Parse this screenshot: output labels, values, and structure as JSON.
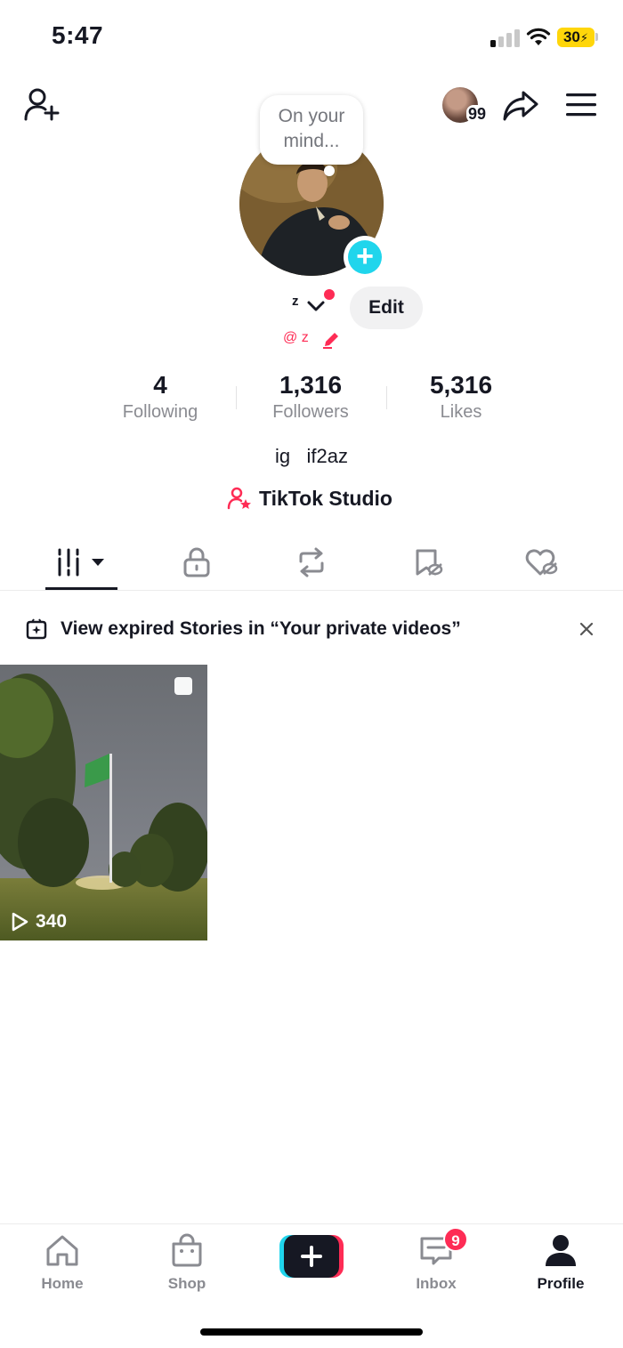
{
  "status_bar": {
    "time": "5:47",
    "battery": "30"
  },
  "header": {
    "notification_count": "99"
  },
  "profile": {
    "bubble_text": "On your mind...",
    "username": "z",
    "handle": "@ z",
    "edit_label": "Edit",
    "stats": [
      {
        "value": "4",
        "label": "Following"
      },
      {
        "value": "1,316",
        "label": "Followers"
      },
      {
        "value": "5,316",
        "label": "Likes"
      }
    ],
    "bio": "ig   if2az",
    "studio_label": "TikTok Studio"
  },
  "banner": {
    "text": "View expired Stories in “Your private videos”"
  },
  "videos": [
    {
      "views": "340"
    }
  ],
  "nav": {
    "home": "Home",
    "shop": "Shop",
    "inbox": "Inbox",
    "profile": "Profile",
    "inbox_badge": "9"
  },
  "colors": {
    "accent": "#fe2c55",
    "story_add": "#20d5ec",
    "battery": "#ffd60a"
  }
}
